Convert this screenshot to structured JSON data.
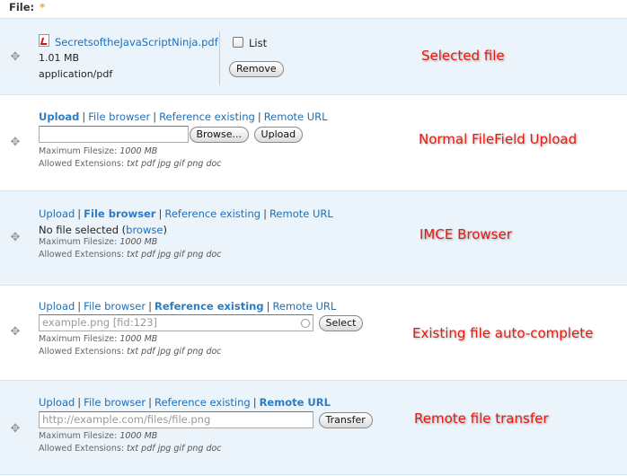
{
  "field": {
    "label": "File:",
    "required_marker": "*"
  },
  "tabs": [
    "Upload",
    "File browser",
    "Reference existing",
    "Remote URL"
  ],
  "separator": "|",
  "limits": {
    "max_label": "Maximum Filesize:",
    "max_value": "1000 MB",
    "ext_label": "Allowed Extensions:",
    "ext_value": "txt pdf jpg gif png doc"
  },
  "selected": {
    "filename": "SecretsoftheJavaScriptNinja.pdf",
    "size": "1.01 MB",
    "mime": "application/pdf",
    "list_label": "List",
    "list_checked": false,
    "remove_label": "Remove",
    "annotation": "Selected file"
  },
  "upload": {
    "browse_label": "Browse...",
    "upload_label": "Upload",
    "file_value": "",
    "annotation": "Normal FileField Upload"
  },
  "imce": {
    "no_file": "No file selected (",
    "browse_link": "browse",
    "close_paren": ")",
    "annotation": "IMCE Browser"
  },
  "reference": {
    "placeholder": "example.png [fid:123]",
    "select_label": "Select",
    "annotation": "Existing file auto-complete"
  },
  "remote": {
    "placeholder": "http://example.com/files/file.png",
    "transfer_label": "Transfer",
    "annotation": "Remote file transfer"
  },
  "colors": {
    "annotation": "#e8190f",
    "link": "#1d6fb8",
    "row_alt": "#ecf4fb",
    "required": "#f7a21a"
  }
}
